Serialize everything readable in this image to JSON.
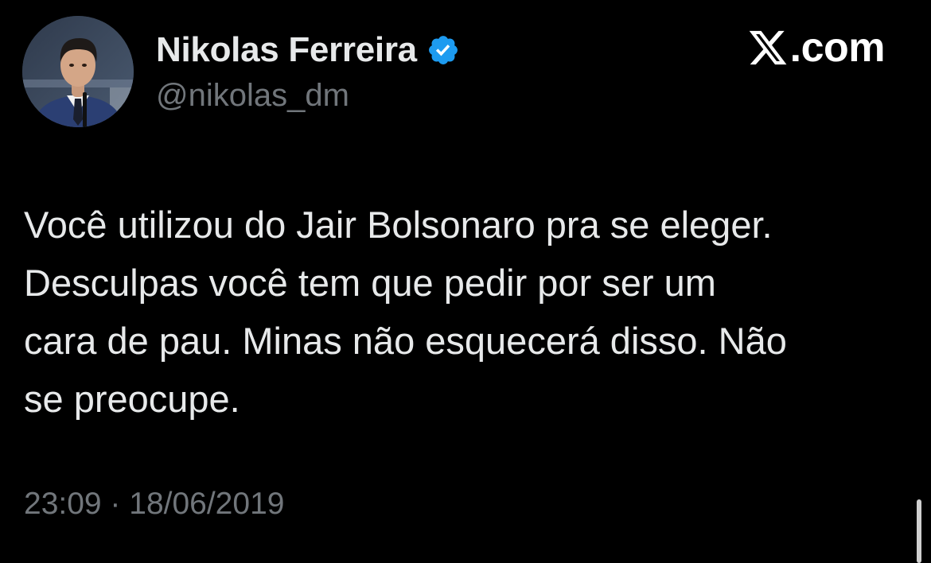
{
  "author": {
    "display_name": "Nikolas Ferreira",
    "handle": "@nikolas_dm",
    "verified": true,
    "verified_color": "#1d9bf0",
    "avatar_icon": "profile-photo"
  },
  "watermark": {
    "logo_icon": "x-logo-icon",
    "text": ".com"
  },
  "tweet": {
    "lines": [
      "Você utilizou do Jair Bolsonaro pra se eleger.",
      "Desculpas você tem que pedir por ser um",
      "cara de pau. Minas não esquecerá disso. Não",
      "se preocupe."
    ],
    "timestamp": "23:09 · 18/06/2019"
  },
  "colors": {
    "background": "#000000",
    "primary_text": "#e7e9ea",
    "secondary_text": "#71767b",
    "accent": "#1d9bf0"
  }
}
